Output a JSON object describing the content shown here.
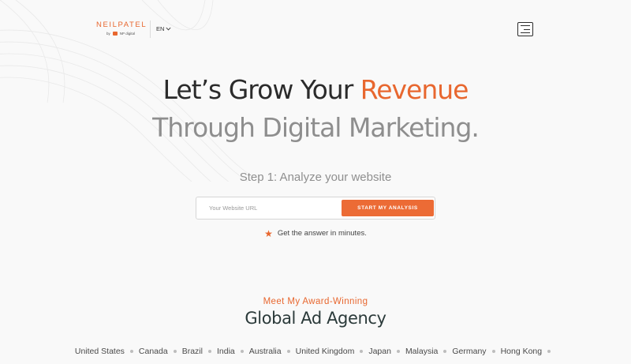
{
  "header": {
    "logo_text": "NEILPATEL",
    "logo_sub": "by",
    "logo_sub_brand": "NP digital",
    "language": "EN",
    "menu_icon": "hamburger-icon"
  },
  "hero": {
    "headline_part1": "Let’s Grow Your ",
    "headline_accent": "Revenue",
    "headline_line2": "Through Digital Marketing.",
    "step_text": "Step 1: Analyze your website",
    "url_placeholder": "Your Website URL",
    "cta_label": "START MY ANALYSIS",
    "note_icon": "star-icon",
    "note_text": "Get the answer in minutes."
  },
  "agency": {
    "kicker": "Meet My Award-Winning",
    "title": "Global Ad Agency",
    "countries": [
      "United States",
      "Canada",
      "Brazil",
      "India",
      "Australia",
      "United Kingdom",
      "Japan",
      "Malaysia",
      "Germany",
      "Hong Kong"
    ]
  },
  "colors": {
    "accent": "#e8672f",
    "cta": "#ec6b35",
    "background": "#f9f9f9",
    "heading": "#2b2b2b",
    "heading_secondary": "#8e8e8e"
  }
}
